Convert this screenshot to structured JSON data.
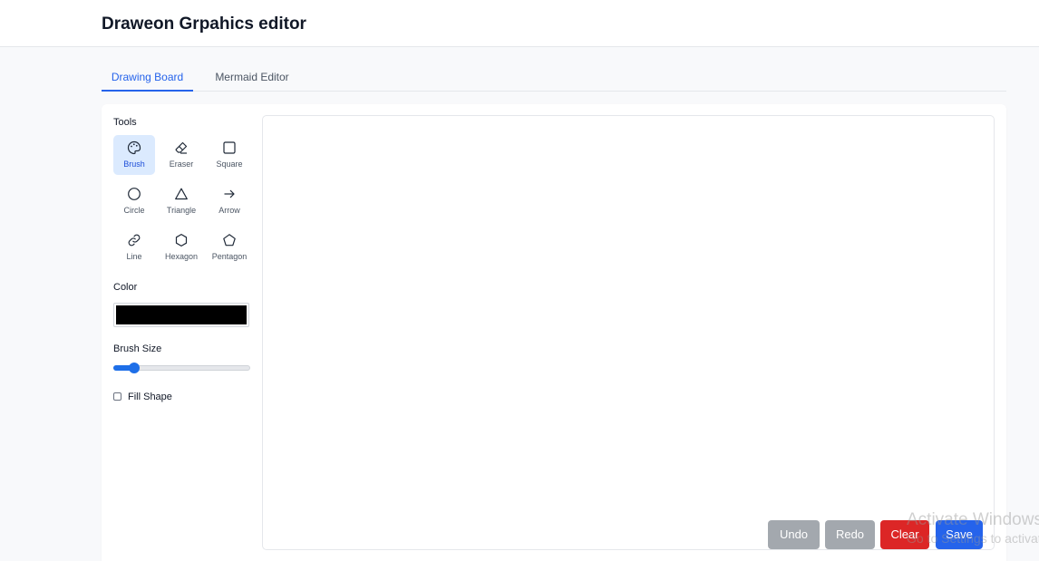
{
  "header": {
    "title": "Draweon Grpahics editor"
  },
  "tabs": [
    {
      "label": "Drawing Board",
      "active": true
    },
    {
      "label": "Mermaid Editor",
      "active": false
    }
  ],
  "sidebar": {
    "tools_label": "Tools",
    "tools": [
      {
        "label": "Brush",
        "icon": "palette-icon",
        "active": true
      },
      {
        "label": "Eraser",
        "icon": "eraser-icon",
        "active": false
      },
      {
        "label": "Square",
        "icon": "square-icon",
        "active": false
      },
      {
        "label": "Circle",
        "icon": "circle-icon",
        "active": false
      },
      {
        "label": "Triangle",
        "icon": "triangle-icon",
        "active": false
      },
      {
        "label": "Arrow",
        "icon": "arrow-right-icon",
        "active": false
      },
      {
        "label": "Line",
        "icon": "link-icon",
        "active": false
      },
      {
        "label": "Hexagon",
        "icon": "hexagon-icon",
        "active": false
      },
      {
        "label": "Pentagon",
        "icon": "pentagon-icon",
        "active": false
      }
    ],
    "color_label": "Color",
    "color_value": "#000000",
    "brush_size_label": "Brush Size",
    "brush_size_fraction": 0.12,
    "fill_shape_label": "Fill Shape",
    "fill_shape_checked": false
  },
  "actions": {
    "undo": "Undo",
    "redo": "Redo",
    "clear": "Clear",
    "save": "Save"
  },
  "watermark": {
    "line1": "Activate Windows",
    "line2": "Go to Settings to activate Windows."
  }
}
